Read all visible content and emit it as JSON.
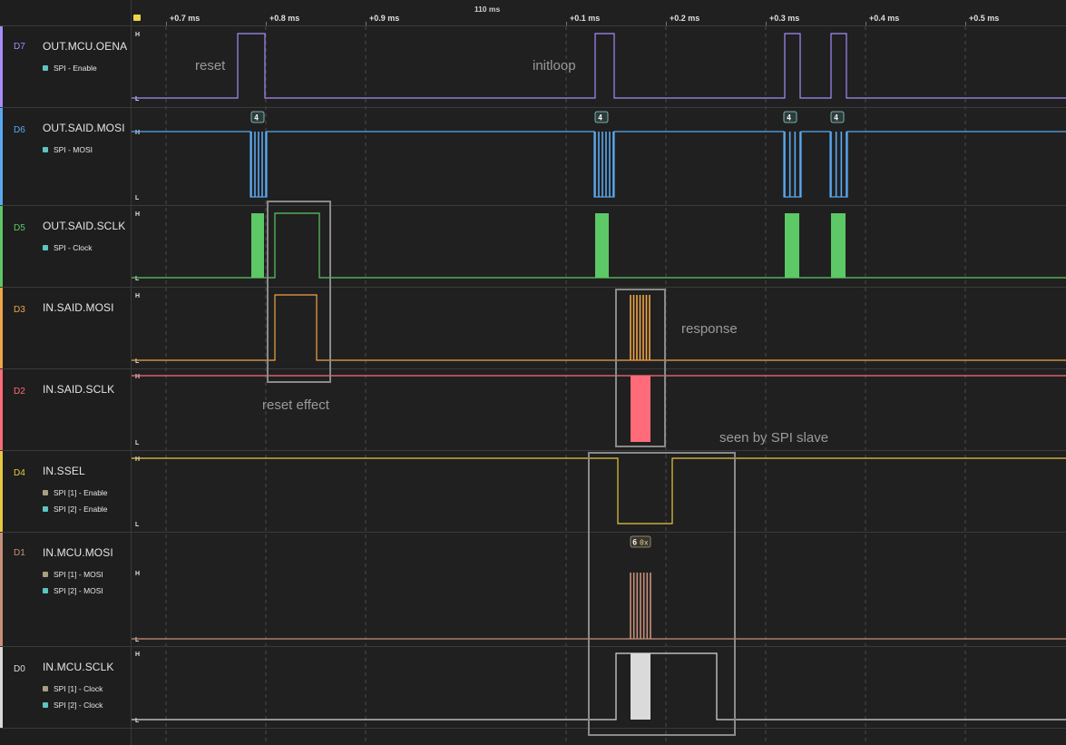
{
  "ruler": {
    "title": "110 ms",
    "ticks": [
      "+0.7 ms",
      "+0.8 ms",
      "+0.9 ms",
      "+0.1 ms",
      "+0.2 ms",
      "+0.3 ms",
      "+0.4 ms",
      "+0.5 ms"
    ]
  },
  "channels": [
    {
      "id": "D7",
      "name": "OUT.MCU.OENA",
      "color": "#a78bfa",
      "tags": [
        {
          "label": "SPI - Enable",
          "color": "#5ec4c0"
        }
      ]
    },
    {
      "id": "D6",
      "name": "OUT.SAID.MOSI",
      "color": "#5aa8f0",
      "tags": [
        {
          "label": "SPI - MOSI",
          "color": "#5ec4c0"
        }
      ]
    },
    {
      "id": "D5",
      "name": "OUT.SAID.SCLK",
      "color": "#5cc866",
      "tags": [
        {
          "label": "SPI - Clock",
          "color": "#5ec4c0"
        }
      ]
    },
    {
      "id": "D3",
      "name": "IN.SAID.MOSI",
      "color": "#f0a446",
      "tags": []
    },
    {
      "id": "D2",
      "name": "IN.SAID.SCLK",
      "color": "#ff6b78",
      "tags": []
    },
    {
      "id": "D4",
      "name": "IN.SSEL",
      "color": "#e8c840",
      "tags": [
        {
          "label": "SPI [1] - Enable",
          "color": "#a89e84"
        },
        {
          "label": "SPI [2] - Enable",
          "color": "#5ec4c0"
        }
      ]
    },
    {
      "id": "D1",
      "name": "IN.MCU.MOSI",
      "color": "#c8907a",
      "tags": [
        {
          "label": "SPI [1] - MOSI",
          "color": "#a89e84"
        },
        {
          "label": "SPI [2] - MOSI",
          "color": "#5ec4c0"
        }
      ]
    },
    {
      "id": "D0",
      "name": "IN.MCU.SCLK",
      "color": "#dadada",
      "tags": [
        {
          "label": "SPI [1] - Clock",
          "color": "#a89e84"
        },
        {
          "label": "SPI [2] - Clock",
          "color": "#5ec4c0"
        }
      ]
    }
  ],
  "level_labels": {
    "high": "H",
    "low": "L"
  },
  "annotations": {
    "reset": "reset",
    "initloop": "initloop",
    "response": "response",
    "reset_effect": "reset effect",
    "seen_by_spi_slave": "seen by SPI slave"
  },
  "decode_bubbles": {
    "mosi_out": "4",
    "mosi_in_value": "6",
    "mosi_in_prefix": "0x"
  },
  "colors": {
    "background": "#202020",
    "grid": "#3a3a3a",
    "highlight_box": "#8a8a8a",
    "annotation_text": "#9a9a9a"
  }
}
